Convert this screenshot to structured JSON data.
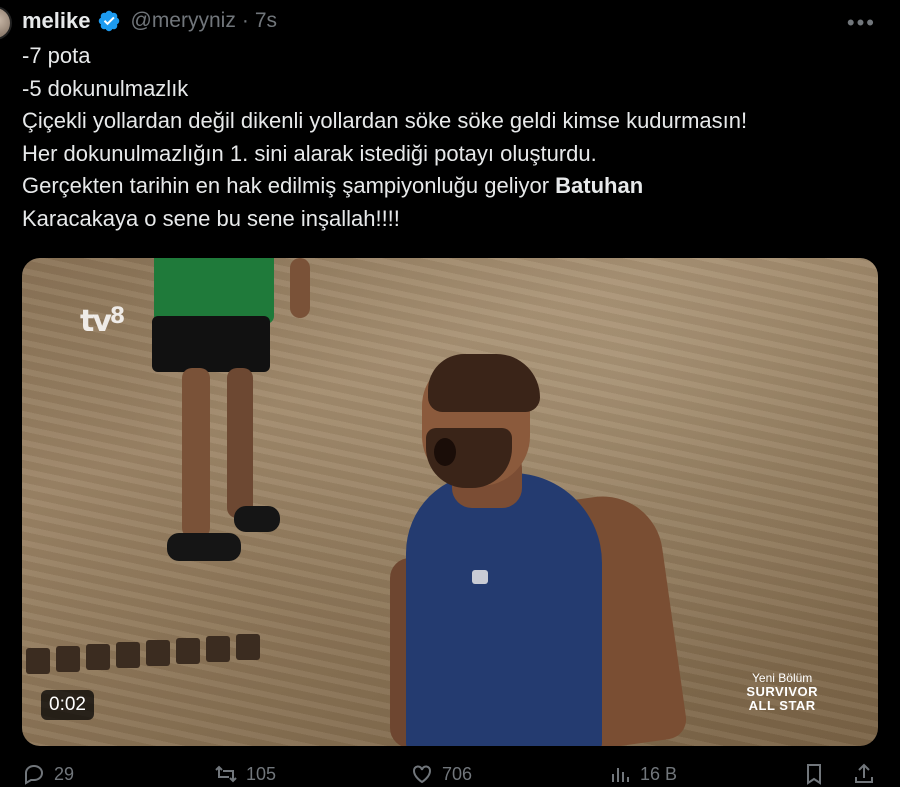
{
  "tweet": {
    "author": {
      "display_name": "melike",
      "handle": "@meryyniz",
      "time": "7s",
      "verified": true
    },
    "more_icon": "more-icon",
    "text_lines": [
      "-7 pota",
      "-5 dokunulmazlık",
      "Çiçekli yollardan değil dikenli yollardan söke söke geldi kimse kudurmasın!",
      "Her dokunulmazlığın 1. sini alarak istediği potayı oluşturdu.",
      "Gerçekten tarihin en hak edilmiş şampiyonluğu geliyor ",
      "Batuhan",
      "Karacakaya o sene bu sene inşallah!!!!"
    ],
    "media": {
      "type": "video",
      "channel_logo": "tv8",
      "duration": "0:02",
      "promo": [
        "Yeni Bölüm",
        "SURVIVOR",
        "ALL STAR"
      ]
    },
    "actions": {
      "reply_count": "29",
      "retweet_count": "105",
      "like_count": "706",
      "views_count": "16 B"
    }
  },
  "colors": {
    "background": "#000000",
    "text": "#e7e9ea",
    "muted": "#71767b",
    "verified": "#1d9bf0"
  }
}
